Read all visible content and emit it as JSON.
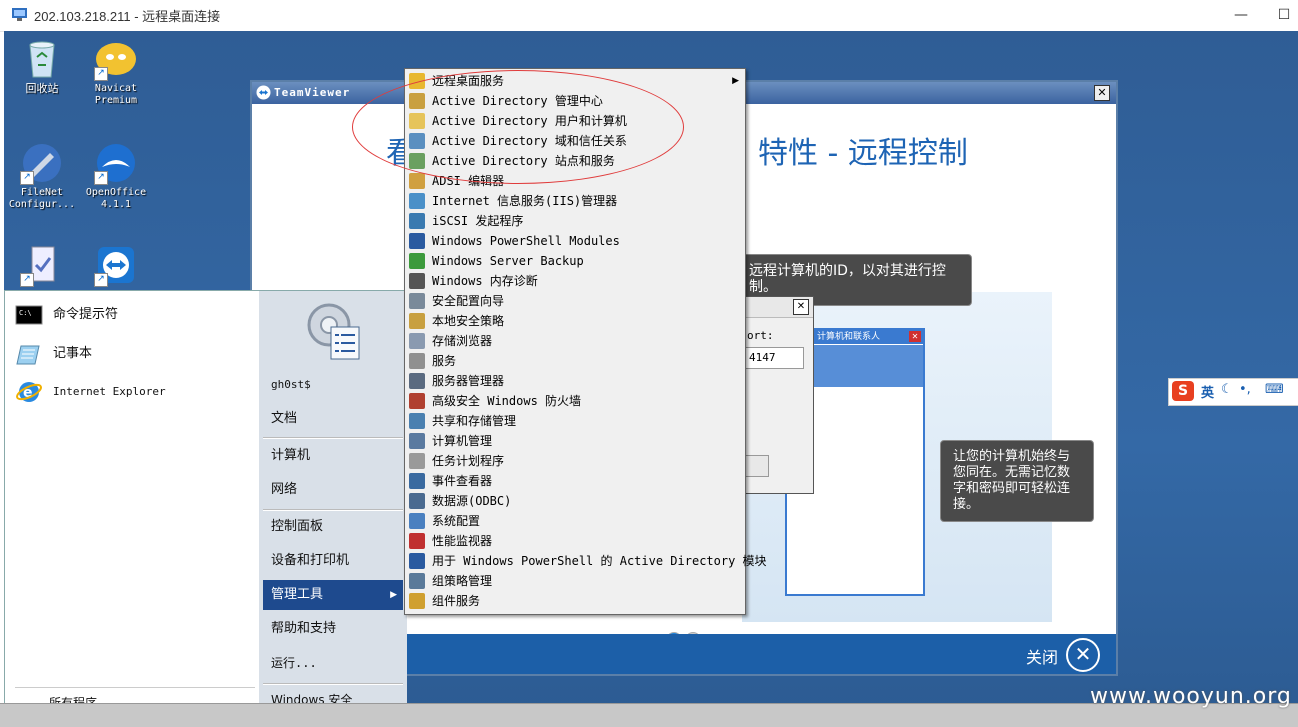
{
  "rdp": {
    "title": "202.103.218.211 - 远程桌面连接",
    "minimize_glyph": "—",
    "maximize_glyph": "☐"
  },
  "desktop_icons": [
    {
      "label": "回收站",
      "icon": "recycle-bin-icon"
    },
    {
      "label": "Navicat Premium",
      "icon": "navicat-icon"
    },
    {
      "label": "FileNet Configur...",
      "icon": "filenet-icon"
    },
    {
      "label": "OpenOffice 4.1.1",
      "icon": "openoffice-icon"
    }
  ],
  "teamviewer": {
    "title": "TeamViewer",
    "heading_left": "看",
    "heading_right": "性 - 远程控制",
    "heading_mid": "特",
    "callout_top": "远程计算机的ID，以对其进行控制。",
    "callout_bottom": "让您的计算机始终与您同在。无需记忆数字和密码即可轻松连接。",
    "inner_panel_title": "计算机和联系人",
    "close_label": "关闭"
  },
  "dialog": {
    "label": "ort:",
    "value": "4147"
  },
  "start_menu": {
    "pinned": [
      {
        "label": "命令提示符",
        "icon": "cmd-icon"
      },
      {
        "label": "记事本",
        "icon": "notepad-icon"
      },
      {
        "label": "Internet Explorer",
        "icon": "ie-icon"
      }
    ],
    "all_programs": "所有程序",
    "right": {
      "user": "gh0st$",
      "documents": "文档",
      "computer": "计算机",
      "network": "网络",
      "control_panel": "控制面板",
      "devices": "设备和打印机",
      "admin_tools": "管理工具",
      "help": "帮助和支持",
      "run": "运行...",
      "windows_security": "Windows 安全"
    }
  },
  "admin_tools_menu": [
    {
      "label": "远程桌面服务",
      "icon": "folder-icon",
      "color": "#e8b830",
      "has_submenu": true
    },
    {
      "label": "Active Directory 管理中心",
      "icon": "ad-admin-center-icon",
      "color": "#c9a040"
    },
    {
      "label": "Active Directory 用户和计算机",
      "icon": "ad-users-icon",
      "color": "#e6c45a"
    },
    {
      "label": "Active Directory 域和信任关系",
      "icon": "ad-domains-icon",
      "color": "#5a8fc0"
    },
    {
      "label": "Active Directory 站点和服务",
      "icon": "ad-sites-icon",
      "color": "#6aa060"
    },
    {
      "label": "ADSI 编辑器",
      "icon": "adsi-edit-icon",
      "color": "#d0a040"
    },
    {
      "label": "Internet 信息服务(IIS)管理器",
      "icon": "iis-icon",
      "color": "#4a90c8"
    },
    {
      "label": "iSCSI 发起程序",
      "icon": "iscsi-icon",
      "color": "#3a7ab0"
    },
    {
      "label": "Windows PowerShell Modules",
      "icon": "powershell-icon",
      "color": "#2a5aa0"
    },
    {
      "label": "Windows Server Backup",
      "icon": "backup-icon",
      "color": "#3c9a3c"
    },
    {
      "label": "Windows 内存诊断",
      "icon": "memory-diagnostic-icon",
      "color": "#555555"
    },
    {
      "label": "安全配置向导",
      "icon": "security-wizard-icon",
      "color": "#7a8a9a"
    },
    {
      "label": "本地安全策略",
      "icon": "local-security-policy-icon",
      "color": "#c8a040"
    },
    {
      "label": "存储浏览器",
      "icon": "storage-explorer-icon",
      "color": "#8a9ab0"
    },
    {
      "label": "服务",
      "icon": "services-icon",
      "color": "#909090"
    },
    {
      "label": "服务器管理器",
      "icon": "server-manager-icon",
      "color": "#5a6a80"
    },
    {
      "label": "高级安全 Windows 防火墙",
      "icon": "firewall-icon",
      "color": "#b04030"
    },
    {
      "label": "共享和存储管理",
      "icon": "share-storage-icon",
      "color": "#4a80b0"
    },
    {
      "label": "计算机管理",
      "icon": "computer-management-icon",
      "color": "#5a7aa0"
    },
    {
      "label": "任务计划程序",
      "icon": "task-scheduler-icon",
      "color": "#9a9a9a"
    },
    {
      "label": "事件查看器",
      "icon": "event-viewer-icon",
      "color": "#3a6aa0"
    },
    {
      "label": "数据源(ODBC)",
      "icon": "odbc-icon",
      "color": "#4a6a90"
    },
    {
      "label": "系统配置",
      "icon": "system-config-icon",
      "color": "#4a80c0"
    },
    {
      "label": "性能监视器",
      "icon": "performance-monitor-icon",
      "color": "#c03030"
    },
    {
      "label": "用于 Windows PowerShell 的 Active Directory 模块",
      "icon": "ad-powershell-icon",
      "color": "#2a5aa0"
    },
    {
      "label": "组策略管理",
      "icon": "group-policy-icon",
      "color": "#5a7a9a"
    },
    {
      "label": "组件服务",
      "icon": "component-services-icon",
      "color": "#d0a030"
    }
  ],
  "ime": {
    "label": "英"
  },
  "watermark": "www.wooyun.org"
}
